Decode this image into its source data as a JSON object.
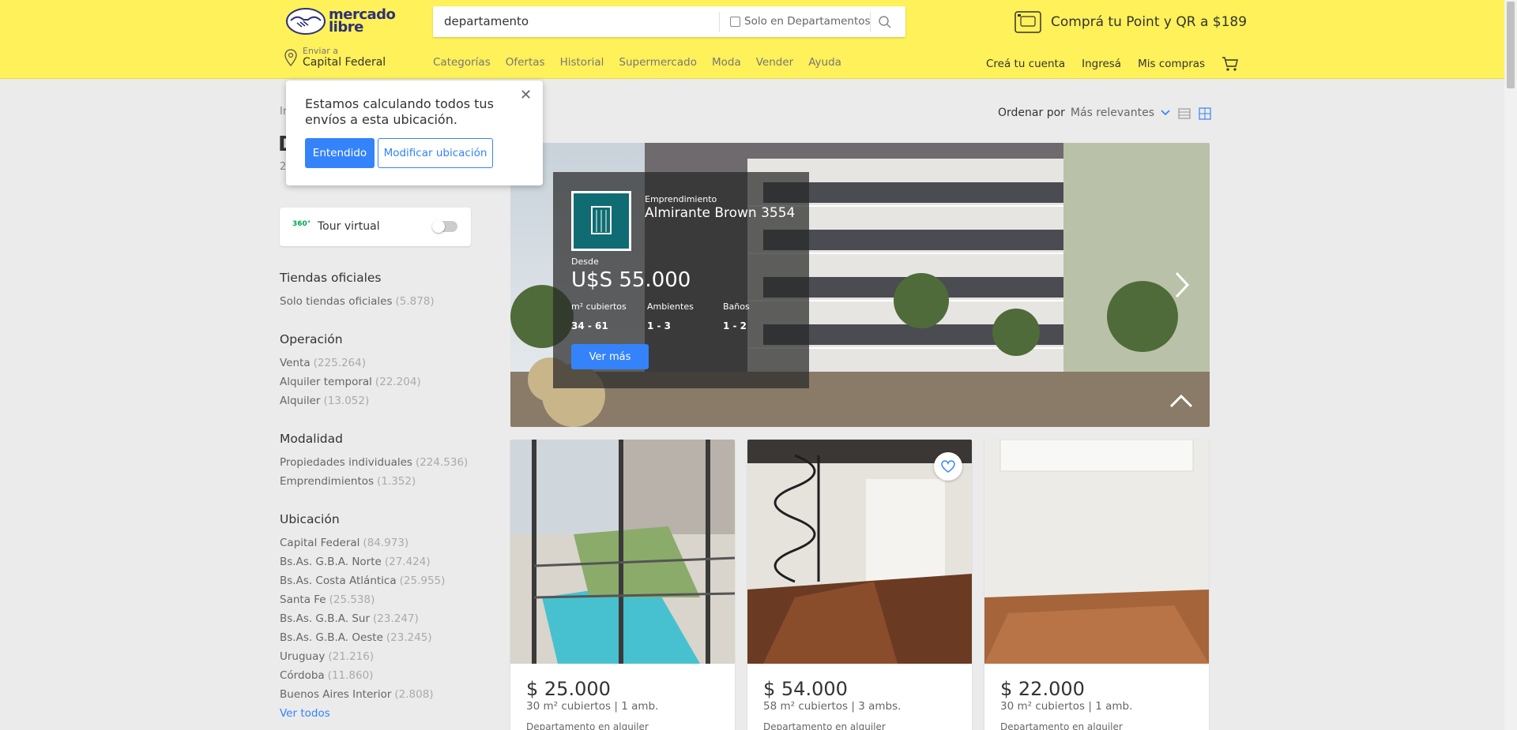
{
  "header": {
    "brand": "mercado libre",
    "search_value": "departamento",
    "search_filter_label": "Solo en Departamentos",
    "promo": "Comprá tu Point y QR a $189",
    "location_label": "Enviar a",
    "location_value": "Capital Federal",
    "nav": [
      "Categorías",
      "Ofertas",
      "Historial",
      "Supermercado",
      "Moda",
      "Vender",
      "Ayuda"
    ],
    "right_nav": [
      "Creá tu cuenta",
      "Ingresá",
      "Mis compras"
    ]
  },
  "popup": {
    "message": "Estamos calculando todos tus envíos a esta ubicación.",
    "ok_label": "Entendido",
    "modify_label": "Modificar ubicación"
  },
  "left": {
    "breadcrumb": "In",
    "title": "D",
    "count": "2",
    "tour_label": "Tour virtual",
    "tour_icon_text": "360°",
    "groups": [
      {
        "title": "Tiendas oficiales",
        "items": [
          {
            "label": "Solo tiendas oficiales",
            "count": "(5.878)"
          }
        ]
      },
      {
        "title": "Operación",
        "items": [
          {
            "label": "Venta",
            "count": "(225.264)"
          },
          {
            "label": "Alquiler temporal",
            "count": "(22.204)"
          },
          {
            "label": "Alquiler",
            "count": "(13.052)"
          }
        ]
      },
      {
        "title": "Modalidad",
        "items": [
          {
            "label": "Propiedades individuales",
            "count": "(224.536)"
          },
          {
            "label": "Emprendimientos",
            "count": "(1.352)"
          }
        ]
      },
      {
        "title": "Ubicación",
        "items": [
          {
            "label": "Capital Federal",
            "count": "(84.973)"
          },
          {
            "label": "Bs.As. G.B.A. Norte",
            "count": "(27.424)"
          },
          {
            "label": "Bs.As. Costa Atlántica",
            "count": "(25.955)"
          },
          {
            "label": "Santa Fe",
            "count": "(25.538)"
          },
          {
            "label": "Bs.As. G.B.A. Sur",
            "count": "(23.247)"
          },
          {
            "label": "Bs.As. G.B.A. Oeste",
            "count": "(23.245)"
          },
          {
            "label": "Uruguay",
            "count": "(21.216)"
          },
          {
            "label": "Córdoba",
            "count": "(11.860)"
          },
          {
            "label": "Buenos Aires Interior",
            "count": "(2.808)"
          }
        ],
        "more": "Ver todos"
      }
    ]
  },
  "sort": {
    "label": "Ordenar por",
    "value": "Más relevantes"
  },
  "banner": {
    "kind": "Emprendimiento",
    "name": "Almirante Brown 3554",
    "desde": "Desde",
    "price": "U$S 55.000",
    "stats": [
      {
        "label": "m² cubiertos",
        "value": "34 - 61"
      },
      {
        "label": "Ambientes",
        "value": "1 - 3"
      },
      {
        "label": "Baños",
        "value": "1 - 2"
      }
    ],
    "cta": "Ver más"
  },
  "cards": [
    {
      "price": "$ 25.000",
      "area": "30 m² cubiertos",
      "rooms": "1 amb.",
      "kind": "Departamento en alquiler"
    },
    {
      "price": "$ 54.000",
      "area": "58 m² cubiertos",
      "rooms": "3 ambs.",
      "kind": "Departamento en alquiler"
    },
    {
      "price": "$ 22.000",
      "area": "30 m² cubiertos",
      "rooms": "1 amb.",
      "kind": "Departamento en alquiler"
    }
  ]
}
